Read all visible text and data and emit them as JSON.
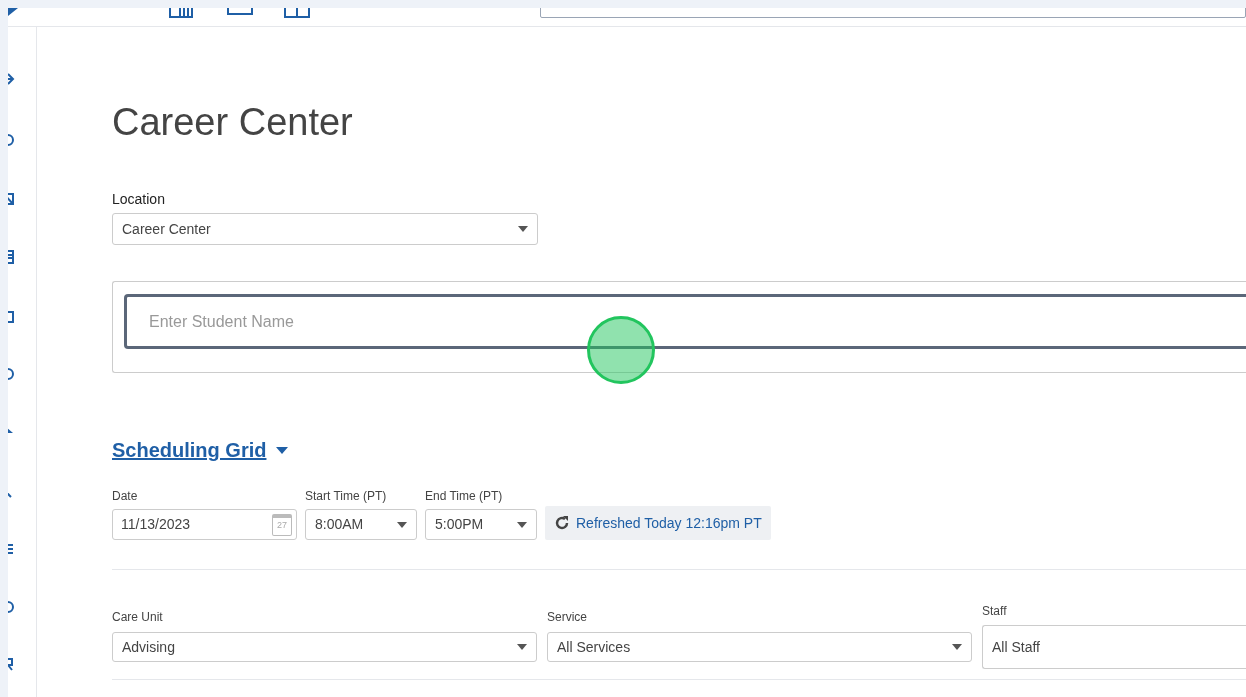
{
  "page": {
    "title": "Career Center"
  },
  "location": {
    "label": "Location",
    "value": "Career Center"
  },
  "student_search": {
    "placeholder": "Enter Student Name"
  },
  "scheduling_grid": {
    "title": "Scheduling Grid",
    "expanded": true
  },
  "date": {
    "label": "Date",
    "value": "11/13/2023",
    "calendar_day": "27"
  },
  "start_time": {
    "label": "Start Time (PT)",
    "value": "8:00AM"
  },
  "end_time": {
    "label": "End Time (PT)",
    "value": "5:00PM"
  },
  "refresh": {
    "label": "Refreshed Today 12:16pm PT"
  },
  "filters": [
    {
      "label": "Care Unit",
      "value": "Advising",
      "kind": "select"
    },
    {
      "label": "Service",
      "value": "All Services",
      "kind": "select"
    },
    {
      "label": "Staff",
      "value": "All Staff",
      "kind": "text"
    }
  ]
}
